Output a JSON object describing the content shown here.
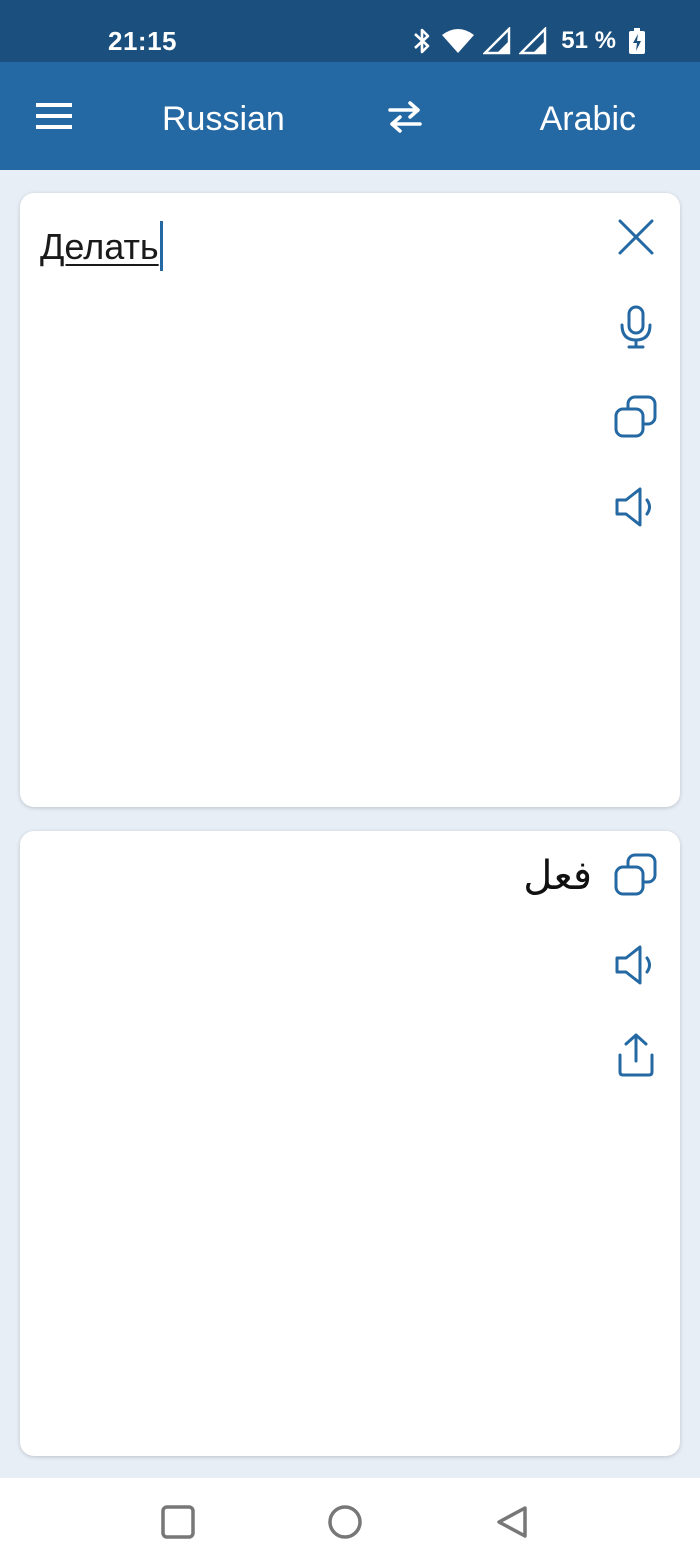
{
  "status_bar": {
    "time": "21:15",
    "battery_text": "51 %",
    "icons": [
      "bluetooth-icon",
      "wifi-icon",
      "signal-icon",
      "signal-icon",
      "battery-charging-icon"
    ]
  },
  "app_bar": {
    "source_language": "Russian",
    "target_language": "Arabic",
    "icons": [
      "menu-icon",
      "swap-icon"
    ],
    "background": "#2469a3"
  },
  "input_card": {
    "text": "Делать",
    "actions": [
      "close-icon",
      "microphone-icon",
      "copy-icon",
      "speaker-icon"
    ]
  },
  "output_card": {
    "text": "فعل",
    "actions": [
      "copy-icon",
      "speaker-icon",
      "share-icon"
    ]
  },
  "nav_bar": {
    "buttons": [
      "recent-apps-icon",
      "home-icon",
      "back-icon"
    ]
  },
  "colors": {
    "accent": "#2469a3",
    "status_bar": "#1b4f7e",
    "background": "#e8eef6"
  }
}
